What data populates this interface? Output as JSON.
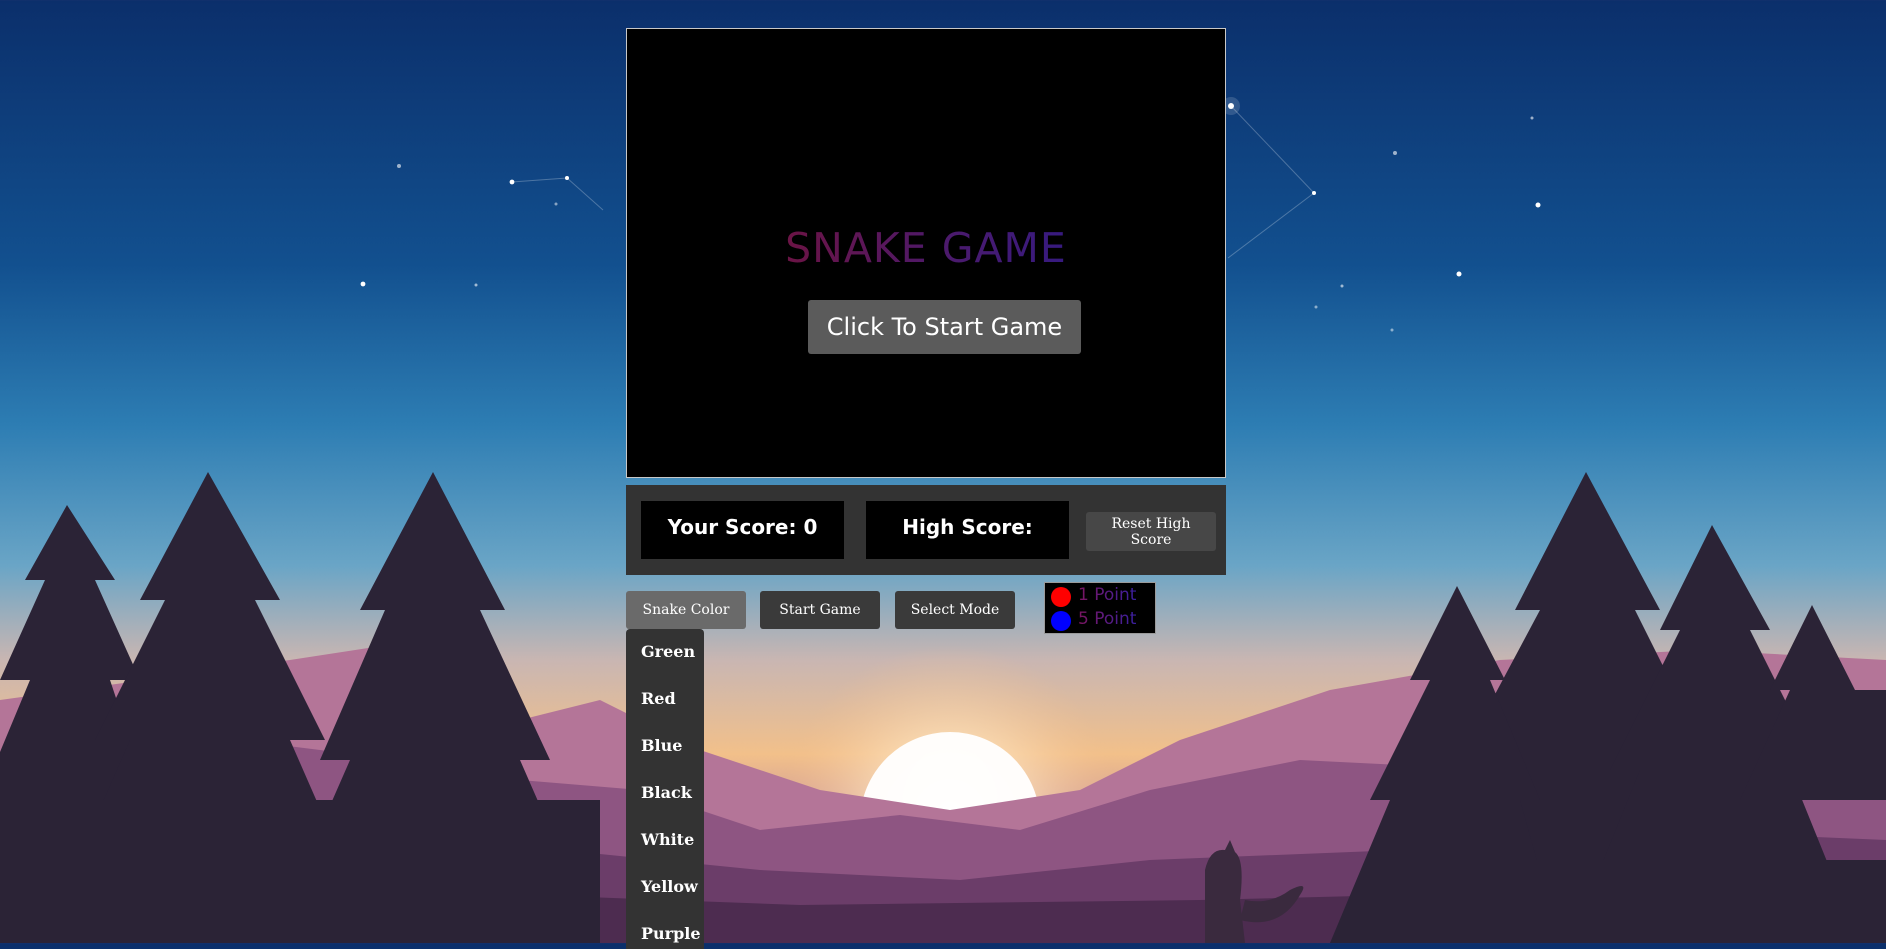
{
  "game": {
    "title": "SNAKE GAME",
    "start_overlay_label": "Click To Start Game"
  },
  "scores": {
    "your_score_label": "Your Score: 0",
    "high_score_label": "High Score:",
    "reset_label": "Reset High Score"
  },
  "controls": {
    "snake_color_label": "Snake Color",
    "start_game_label": "Start Game",
    "select_mode_label": "Select Mode"
  },
  "legend": [
    {
      "label": "1 Point",
      "color": "#ff0000"
    },
    {
      "label": "5 Point",
      "color": "#0000ff"
    }
  ],
  "color_menu": {
    "items": [
      "Green",
      "Red",
      "Blue",
      "Black",
      "White",
      "Yellow",
      "Purple"
    ]
  }
}
